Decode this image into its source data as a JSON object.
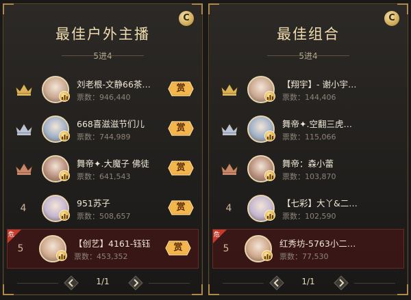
{
  "colors": {
    "gold": "#d9b25a",
    "silver": "#b8c4d6",
    "bronze": "#c8876a",
    "title": "#f0ddb0",
    "highlight": "#5a1c1c",
    "danger_tag": "#c53a2a"
  },
  "panels": [
    {
      "title": "最佳户外主播",
      "help_icon": "C",
      "stage": "5进4",
      "page": "1/1",
      "rows": [
        {
          "rank_icon": "crown-gold",
          "rank": "",
          "name": "刘老根-文静66茶…",
          "votes_label": "票数：",
          "votes": "946,440",
          "reward": "赏",
          "danger": false
        },
        {
          "rank_icon": "crown-silver",
          "rank": "",
          "name": "668喜滋滋节们儿",
          "votes_label": "票数：",
          "votes": "744,989",
          "reward": "赏",
          "danger": false
        },
        {
          "rank_icon": "crown-bronze",
          "rank": "",
          "name": "舞帝✦.大魔子 佛徒",
          "votes_label": "票数：",
          "votes": "641,543",
          "reward": "赏",
          "danger": false
        },
        {
          "rank_icon": "",
          "rank": "4",
          "name": "951苏子",
          "votes_label": "票数：",
          "votes": "508,657",
          "reward": "赏",
          "danger": false
        },
        {
          "rank_icon": "",
          "rank": "5",
          "name": "【创艺】4161-钰钰",
          "votes_label": "票数：",
          "votes": "453,352",
          "reward": "赏",
          "danger": true,
          "danger_text": "危"
        }
      ]
    },
    {
      "title": "最佳组合",
      "help_icon": "C",
      "stage": "5进4",
      "page": "1/1",
      "rows": [
        {
          "rank_icon": "crown-gold",
          "rank": "",
          "name": "【翔宇】- 谢小宇…",
          "votes_label": "票数：",
          "votes": "144,406",
          "reward": "",
          "danger": false
        },
        {
          "rank_icon": "crown-silver",
          "rank": "",
          "name": "舞帝✦.空翻三虎…",
          "votes_label": "票数：",
          "votes": "115,066",
          "reward": "",
          "danger": false
        },
        {
          "rank_icon": "crown-bronze",
          "rank": "",
          "name": "舞帝：森小蕾",
          "votes_label": "票数：",
          "votes": "103,870",
          "reward": "",
          "danger": false
        },
        {
          "rank_icon": "",
          "rank": "4",
          "name": "【七彩】大丫&二…",
          "votes_label": "票数：",
          "votes": "102,590",
          "reward": "",
          "danger": false
        },
        {
          "rank_icon": "",
          "rank": "5",
          "name": "红秀坊-5763小二…",
          "votes_label": "票数：",
          "votes": "77,530",
          "reward": "",
          "danger": true,
          "danger_text": "危"
        }
      ]
    }
  ]
}
